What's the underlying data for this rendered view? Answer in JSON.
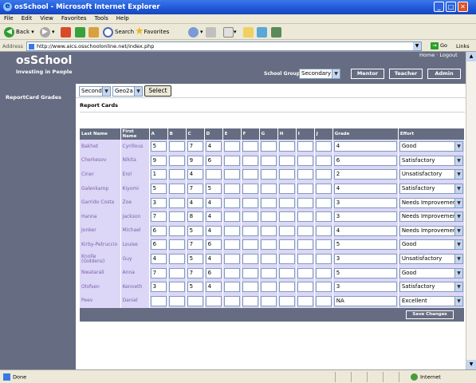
{
  "window": {
    "title": "osSchool - Microsoft Internet Explorer"
  },
  "menu": [
    "File",
    "Edit",
    "View",
    "Favorites",
    "Tools",
    "Help"
  ],
  "toolbar": {
    "back": "Back",
    "search": "Search",
    "favorites": "Favorites"
  },
  "address": {
    "label": "Address",
    "url": "http://www.aics.osschoolonline.net/index.php",
    "go": "Go",
    "links": "Links"
  },
  "site": {
    "logo": "osSchool",
    "tagline": "Investing in People",
    "top_links": "Home · Logout",
    "school_group_label": "School Group :",
    "school_group_value": "Secondary",
    "nav_buttons": [
      "Mentor",
      "Teacher",
      "Admin"
    ]
  },
  "sidebar": {
    "items": [
      "ReportCard Grades"
    ]
  },
  "filters": {
    "grade_level": "Second",
    "class": "Geo2a",
    "select_button": "Select"
  },
  "report": {
    "title": "Report Cards",
    "headers": [
      "Last Name",
      "First Name",
      "A",
      "B",
      "C",
      "D",
      "E",
      "F",
      "G",
      "H",
      "I",
      "J",
      "Grade",
      "Effort"
    ],
    "rows": [
      {
        "last": "Bakhet",
        "first": "Cyrillous",
        "scores": [
          "5",
          "",
          "7",
          "4",
          "",
          "",
          "",
          "",
          "",
          ""
        ],
        "grade": "4",
        "effort": "Good"
      },
      {
        "last": "Cherkesov",
        "first": "Nikita",
        "scores": [
          "9",
          "",
          "9",
          "6",
          "",
          "",
          "",
          "",
          "",
          ""
        ],
        "grade": "6",
        "effort": "Satisfactory"
      },
      {
        "last": "Ciner",
        "first": "Erol",
        "scores": [
          "1",
          "",
          "4",
          "",
          "",
          "",
          "",
          "",
          "",
          ""
        ],
        "grade": "2",
        "effort": "Unsatisfactory"
      },
      {
        "last": "Galenkamp",
        "first": "Kiyomi",
        "scores": [
          "5",
          "",
          "7",
          "5",
          "",
          "",
          "",
          "",
          "",
          ""
        ],
        "grade": "4",
        "effort": "Satisfactory"
      },
      {
        "last": "Garrido Costa",
        "first": "Zoe",
        "scores": [
          "3",
          "",
          "4",
          "4",
          "",
          "",
          "",
          "",
          "",
          ""
        ],
        "grade": "3",
        "effort": "Needs Improvement"
      },
      {
        "last": "Hanna",
        "first": "Jackson",
        "scores": [
          "7",
          "",
          "8",
          "4",
          "",
          "",
          "",
          "",
          "",
          ""
        ],
        "grade": "3",
        "effort": "Needs Improvement"
      },
      {
        "last": "Jonker",
        "first": "Michael",
        "scores": [
          "6",
          "",
          "5",
          "4",
          "",
          "",
          "",
          "",
          "",
          ""
        ],
        "grade": "4",
        "effort": "Needs Improvement"
      },
      {
        "last": "Kirby-Petruccio",
        "first": "Louise",
        "scores": [
          "6",
          "",
          "7",
          "6",
          "",
          "",
          "",
          "",
          "",
          ""
        ],
        "grade": "5",
        "effort": "Good"
      },
      {
        "last": "Knolle (Giddens)",
        "first": "Guy",
        "scores": [
          "4",
          "",
          "5",
          "4",
          "",
          "",
          "",
          "",
          "",
          ""
        ],
        "grade": "3",
        "effort": "Unsatisfactory"
      },
      {
        "last": "Nwatarali",
        "first": "Anna",
        "scores": [
          "7",
          "",
          "7",
          "6",
          "",
          "",
          "",
          "",
          "",
          ""
        ],
        "grade": "5",
        "effort": "Good"
      },
      {
        "last": "Olofsen",
        "first": "Kenneth",
        "scores": [
          "3",
          "",
          "5",
          "4",
          "",
          "",
          "",
          "",
          "",
          ""
        ],
        "grade": "3",
        "effort": "Satisfactory"
      },
      {
        "last": "Peev",
        "first": "Daniel",
        "scores": [
          "",
          "",
          "",
          "",
          "",
          "",
          "",
          "",
          "",
          ""
        ],
        "grade": "NA",
        "effort": "Excellent"
      }
    ],
    "save_button": "Save Changes"
  },
  "status": {
    "left": "Done",
    "right": "Internet"
  }
}
